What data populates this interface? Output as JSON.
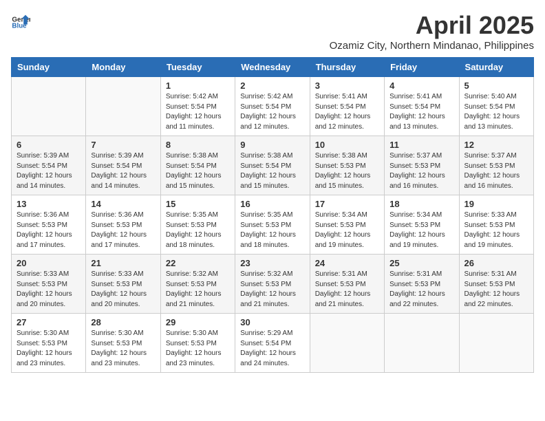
{
  "header": {
    "logo_general": "General",
    "logo_blue": "Blue",
    "title": "April 2025",
    "subtitle": "Ozamiz City, Northern Mindanao, Philippines"
  },
  "weekdays": [
    "Sunday",
    "Monday",
    "Tuesday",
    "Wednesday",
    "Thursday",
    "Friday",
    "Saturday"
  ],
  "weeks": [
    [
      {
        "day": "",
        "info": ""
      },
      {
        "day": "",
        "info": ""
      },
      {
        "day": "1",
        "info": "Sunrise: 5:42 AM\nSunset: 5:54 PM\nDaylight: 12 hours and 11 minutes."
      },
      {
        "day": "2",
        "info": "Sunrise: 5:42 AM\nSunset: 5:54 PM\nDaylight: 12 hours and 12 minutes."
      },
      {
        "day": "3",
        "info": "Sunrise: 5:41 AM\nSunset: 5:54 PM\nDaylight: 12 hours and 12 minutes."
      },
      {
        "day": "4",
        "info": "Sunrise: 5:41 AM\nSunset: 5:54 PM\nDaylight: 12 hours and 13 minutes."
      },
      {
        "day": "5",
        "info": "Sunrise: 5:40 AM\nSunset: 5:54 PM\nDaylight: 12 hours and 13 minutes."
      }
    ],
    [
      {
        "day": "6",
        "info": "Sunrise: 5:39 AM\nSunset: 5:54 PM\nDaylight: 12 hours and 14 minutes."
      },
      {
        "day": "7",
        "info": "Sunrise: 5:39 AM\nSunset: 5:54 PM\nDaylight: 12 hours and 14 minutes."
      },
      {
        "day": "8",
        "info": "Sunrise: 5:38 AM\nSunset: 5:54 PM\nDaylight: 12 hours and 15 minutes."
      },
      {
        "day": "9",
        "info": "Sunrise: 5:38 AM\nSunset: 5:54 PM\nDaylight: 12 hours and 15 minutes."
      },
      {
        "day": "10",
        "info": "Sunrise: 5:38 AM\nSunset: 5:53 PM\nDaylight: 12 hours and 15 minutes."
      },
      {
        "day": "11",
        "info": "Sunrise: 5:37 AM\nSunset: 5:53 PM\nDaylight: 12 hours and 16 minutes."
      },
      {
        "day": "12",
        "info": "Sunrise: 5:37 AM\nSunset: 5:53 PM\nDaylight: 12 hours and 16 minutes."
      }
    ],
    [
      {
        "day": "13",
        "info": "Sunrise: 5:36 AM\nSunset: 5:53 PM\nDaylight: 12 hours and 17 minutes."
      },
      {
        "day": "14",
        "info": "Sunrise: 5:36 AM\nSunset: 5:53 PM\nDaylight: 12 hours and 17 minutes."
      },
      {
        "day": "15",
        "info": "Sunrise: 5:35 AM\nSunset: 5:53 PM\nDaylight: 12 hours and 18 minutes."
      },
      {
        "day": "16",
        "info": "Sunrise: 5:35 AM\nSunset: 5:53 PM\nDaylight: 12 hours and 18 minutes."
      },
      {
        "day": "17",
        "info": "Sunrise: 5:34 AM\nSunset: 5:53 PM\nDaylight: 12 hours and 19 minutes."
      },
      {
        "day": "18",
        "info": "Sunrise: 5:34 AM\nSunset: 5:53 PM\nDaylight: 12 hours and 19 minutes."
      },
      {
        "day": "19",
        "info": "Sunrise: 5:33 AM\nSunset: 5:53 PM\nDaylight: 12 hours and 19 minutes."
      }
    ],
    [
      {
        "day": "20",
        "info": "Sunrise: 5:33 AM\nSunset: 5:53 PM\nDaylight: 12 hours and 20 minutes."
      },
      {
        "day": "21",
        "info": "Sunrise: 5:33 AM\nSunset: 5:53 PM\nDaylight: 12 hours and 20 minutes."
      },
      {
        "day": "22",
        "info": "Sunrise: 5:32 AM\nSunset: 5:53 PM\nDaylight: 12 hours and 21 minutes."
      },
      {
        "day": "23",
        "info": "Sunrise: 5:32 AM\nSunset: 5:53 PM\nDaylight: 12 hours and 21 minutes."
      },
      {
        "day": "24",
        "info": "Sunrise: 5:31 AM\nSunset: 5:53 PM\nDaylight: 12 hours and 21 minutes."
      },
      {
        "day": "25",
        "info": "Sunrise: 5:31 AM\nSunset: 5:53 PM\nDaylight: 12 hours and 22 minutes."
      },
      {
        "day": "26",
        "info": "Sunrise: 5:31 AM\nSunset: 5:53 PM\nDaylight: 12 hours and 22 minutes."
      }
    ],
    [
      {
        "day": "27",
        "info": "Sunrise: 5:30 AM\nSunset: 5:53 PM\nDaylight: 12 hours and 23 minutes."
      },
      {
        "day": "28",
        "info": "Sunrise: 5:30 AM\nSunset: 5:53 PM\nDaylight: 12 hours and 23 minutes."
      },
      {
        "day": "29",
        "info": "Sunrise: 5:30 AM\nSunset: 5:53 PM\nDaylight: 12 hours and 23 minutes."
      },
      {
        "day": "30",
        "info": "Sunrise: 5:29 AM\nSunset: 5:54 PM\nDaylight: 12 hours and 24 minutes."
      },
      {
        "day": "",
        "info": ""
      },
      {
        "day": "",
        "info": ""
      },
      {
        "day": "",
        "info": ""
      }
    ]
  ]
}
